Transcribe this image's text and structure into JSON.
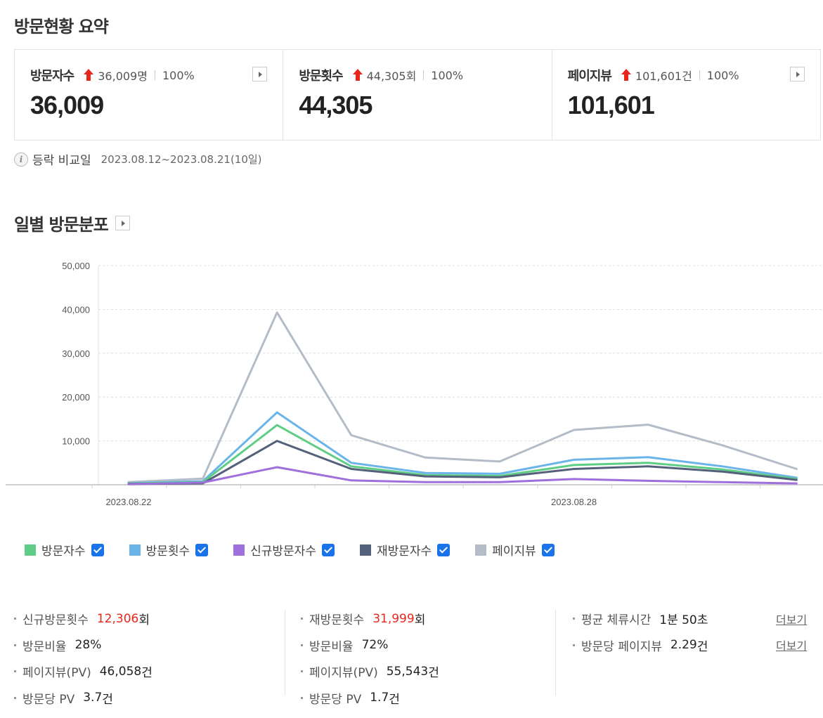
{
  "summary": {
    "title": "방문현황 요약",
    "cards": [
      {
        "label": "방문자수",
        "diff": "36,009명",
        "pct": "100%",
        "value": "36,009"
      },
      {
        "label": "방문횟수",
        "diff": "44,305회",
        "pct": "100%",
        "value": "44,305"
      },
      {
        "label": "페이지뷰",
        "diff": "101,601건",
        "pct": "100%",
        "value": "101,601"
      }
    ],
    "compare_label": "등락 비교일",
    "compare_range": "2023.08.12~2023.08.21(10일)"
  },
  "daily": {
    "title": "일별 방문분포"
  },
  "chart_data": {
    "type": "line",
    "x": [
      "2023.08.22",
      "2023.08.23",
      "2023.08.24",
      "2023.08.25",
      "2023.08.26",
      "2023.08.27",
      "2023.08.28",
      "2023.08.29",
      "2023.08.30",
      "2023.08.31"
    ],
    "x_tick_labels": [
      {
        "index": 0,
        "label": "2023.08.22"
      },
      {
        "index": 6,
        "label": "2023.08.28"
      }
    ],
    "ylim": [
      0,
      50000
    ],
    "y_ticks": [
      "10,000",
      "20,000",
      "30,000",
      "40,000",
      "50,000"
    ],
    "y_tick_values": [
      10000,
      20000,
      30000,
      40000,
      50000
    ],
    "grid": true,
    "series": [
      {
        "name": "페이지뷰",
        "color": "#b4bcc8",
        "values": [
          600,
          1400,
          39300,
          11300,
          6200,
          5300,
          12500,
          13700,
          9000,
          3600
        ]
      },
      {
        "name": "방문횟수",
        "color": "#6ab4ea",
        "values": [
          350,
          800,
          16500,
          5000,
          2700,
          2500,
          5700,
          6300,
          4200,
          1600
        ]
      },
      {
        "name": "방문자수",
        "color": "#5fce84",
        "values": [
          300,
          600,
          13600,
          4200,
          2200,
          2000,
          4500,
          5000,
          3500,
          1300
        ]
      },
      {
        "name": "재방문자수",
        "color": "#55607a",
        "values": [
          200,
          300,
          10000,
          3600,
          1900,
          1700,
          3600,
          4200,
          3000,
          1100
        ]
      },
      {
        "name": "신규방문자수",
        "color": "#9f6fdc",
        "values": [
          150,
          500,
          4000,
          1000,
          600,
          600,
          1300,
          900,
          600,
          300
        ]
      }
    ]
  },
  "legend": [
    {
      "label": "방문자수",
      "color": "#5fce84"
    },
    {
      "label": "방문횟수",
      "color": "#6ab4ea"
    },
    {
      "label": "신규방문자수",
      "color": "#9f6fdc"
    },
    {
      "label": "재방문자수",
      "color": "#55607a"
    },
    {
      "label": "페이지뷰",
      "color": "#b4bcc8"
    }
  ],
  "stats": {
    "new": [
      {
        "label": "신규방문횟수",
        "value": "12,306",
        "unit": "회",
        "highlight": true
      },
      {
        "label": "방문비율",
        "value": "28%",
        "unit": ""
      },
      {
        "label": "페이지뷰(PV)",
        "value": "46,058",
        "unit": "건"
      },
      {
        "label": "방문당 PV",
        "value": "3.7",
        "unit": "건"
      }
    ],
    "returning": [
      {
        "label": "재방문횟수",
        "value": "31,999",
        "unit": "회",
        "highlight": true
      },
      {
        "label": "방문비율",
        "value": "72%",
        "unit": ""
      },
      {
        "label": "페이지뷰(PV)",
        "value": "55,543",
        "unit": "건"
      },
      {
        "label": "방문당 PV",
        "value": "1.7",
        "unit": "건"
      }
    ],
    "other": [
      {
        "label": "평균 체류시간",
        "value": "1분 50초",
        "unit": ""
      },
      {
        "label": "방문당 페이지뷰",
        "value": "2.29",
        "unit": "건"
      }
    ],
    "more_label": "더보기"
  }
}
